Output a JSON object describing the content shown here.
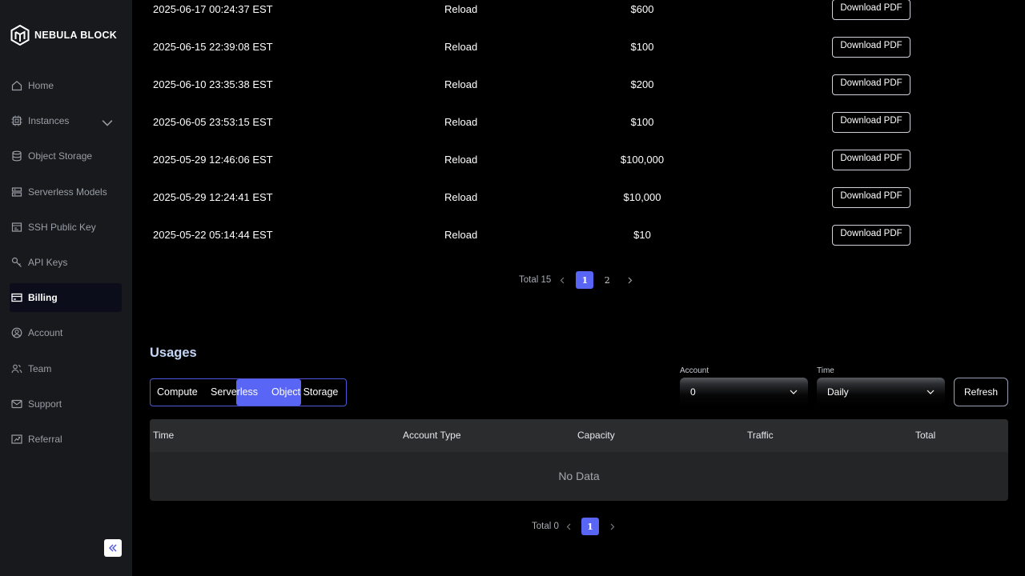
{
  "app": {
    "brand": "NEBULA BLOCK"
  },
  "sidebar": {
    "items": [
      {
        "label": "Home",
        "icon": "home-icon"
      },
      {
        "label": "Instances",
        "icon": "cpu-icon",
        "expandable": true
      },
      {
        "label": "Object Storage",
        "icon": "database-icon"
      },
      {
        "label": "Serverless Models",
        "icon": "server-icon"
      },
      {
        "label": "SSH Public Key",
        "icon": "ssh-key-icon"
      },
      {
        "label": "API Keys",
        "icon": "key-icon"
      },
      {
        "label": "Billing",
        "icon": "billing-icon",
        "active": true
      },
      {
        "label": "Account",
        "icon": "user-circle-icon"
      },
      {
        "label": "Team",
        "icon": "team-icon"
      },
      {
        "label": "Support",
        "icon": "mail-icon"
      },
      {
        "label": "Referral",
        "icon": "referral-icon"
      }
    ]
  },
  "billing": {
    "rows": [
      {
        "time": "2025-06-17 00:24:37 EST",
        "type": "Reload",
        "amount": "$600",
        "action": "Download PDF"
      },
      {
        "time": "2025-06-15 22:39:08 EST",
        "type": "Reload",
        "amount": "$100",
        "action": "Download PDF"
      },
      {
        "time": "2025-06-10 23:35:38 EST",
        "type": "Reload",
        "amount": "$200",
        "action": "Download PDF"
      },
      {
        "time": "2025-06-05 23:53:15 EST",
        "type": "Reload",
        "amount": "$100",
        "action": "Download PDF"
      },
      {
        "time": "2025-05-29 12:46:06 EST",
        "type": "Reload",
        "amount": "$100,000",
        "action": "Download PDF"
      },
      {
        "time": "2025-05-29 12:24:41 EST",
        "type": "Reload",
        "amount": "$10,000",
        "action": "Download PDF"
      },
      {
        "time": "2025-05-22 05:14:44 EST",
        "type": "Reload",
        "amount": "$10",
        "action": "Download PDF"
      }
    ],
    "pagination": {
      "total": "Total 15",
      "pages": [
        "1",
        "2"
      ],
      "current": "1"
    }
  },
  "usages": {
    "title": "Usages",
    "tabs": [
      "Compute",
      "Serverless",
      "Object Storage"
    ],
    "active_tab": "Serverless",
    "account_label": "Account",
    "account_value": "0",
    "time_label": "Time",
    "time_value": "Daily",
    "refresh_label": "Refresh",
    "columns": [
      "Time",
      "Account Type",
      "Capacity",
      "Traffic",
      "Total"
    ],
    "empty_text": "No Data",
    "pagination": {
      "total": "Total 0",
      "pages": [
        "1"
      ],
      "current": "1"
    }
  },
  "colors": {
    "accent": "#5965f5",
    "sidebar_bg": "#17191c",
    "page_bg": "#000000",
    "title": "#c4d6f5"
  }
}
